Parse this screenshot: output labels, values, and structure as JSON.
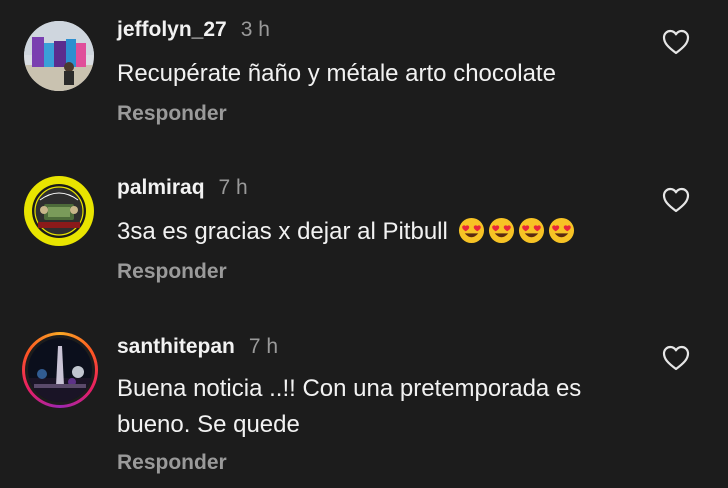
{
  "comments": [
    {
      "username": "jeffolyn_27",
      "time": "3 h",
      "text": "Recupérate ñaño y métale arto chocolate",
      "reply_label": "Responder",
      "avatar": "beach-photo-avatar",
      "like_icon": "heart-outline-icon"
    },
    {
      "username": "palmiraq",
      "time": "7 h",
      "text": "3sa es gracias x dejar al Pitbull",
      "emojis": [
        "heart-eyes-emoji",
        "heart-eyes-emoji",
        "heart-eyes-emoji",
        "heart-eyes-emoji"
      ],
      "reply_label": "Responder",
      "avatar": "palmira-badge-avatar",
      "like_icon": "heart-outline-icon"
    },
    {
      "username": "santhitepan",
      "time": "7 h",
      "text_line1": "Buena noticia ..!! Con una pretemporada es",
      "text_line2": "bueno. Se quede",
      "reply_label": "Responder",
      "avatar": "night-monument-avatar",
      "avatar_story_ring": true,
      "like_icon": "heart-outline-icon"
    }
  ],
  "colors": {
    "background": "#1c1c1c",
    "primary_text": "#f2f2f2",
    "secondary_text": "#9a9a9a"
  }
}
